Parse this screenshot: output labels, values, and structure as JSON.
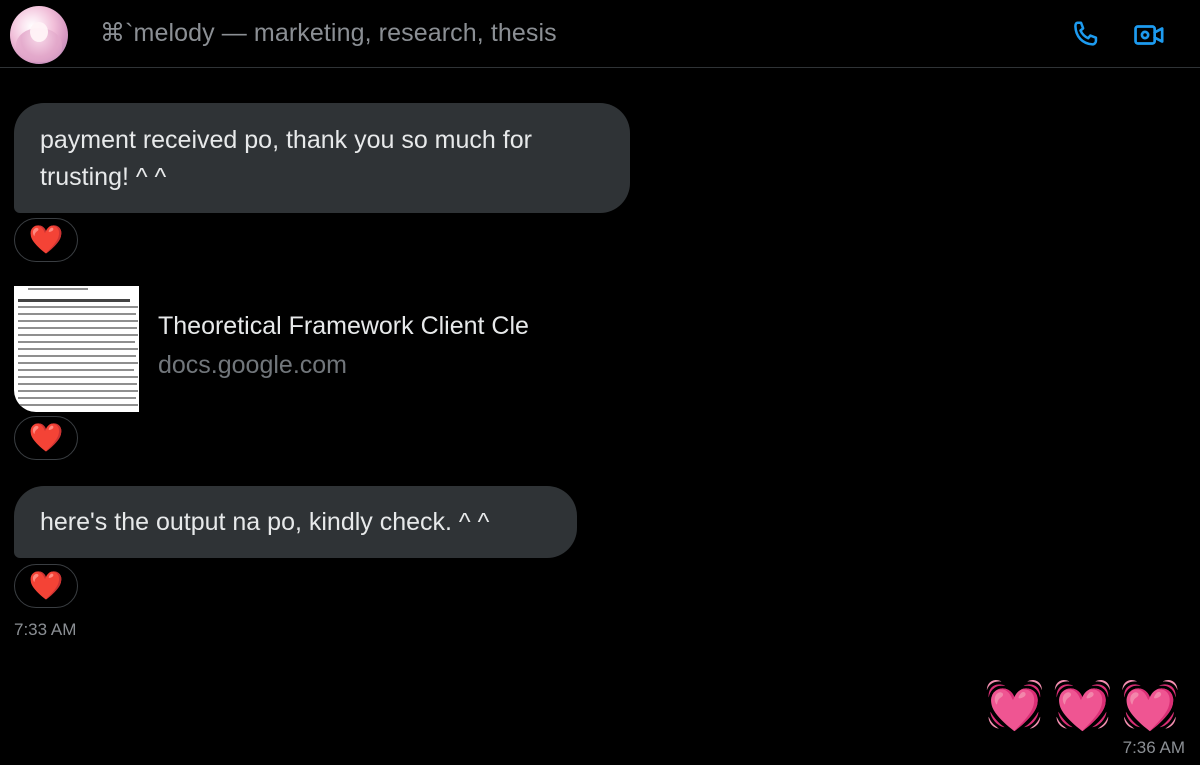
{
  "header": {
    "title": "⌘`melody — marketing, research, thesis",
    "phone_icon": "phone-icon",
    "video_icon": "video-call-icon",
    "accent_color": "#1d9bf0"
  },
  "messages": [
    {
      "text": "payment received po, thank you so much for trusting! ^ ^",
      "reaction": "❤️"
    },
    {
      "link_title": "Theoretical Framework Client Cle",
      "link_domain": "docs.google.com",
      "reaction": "❤️"
    },
    {
      "text": "here's the output na po, kindly check. ^ ^",
      "reaction": "❤️",
      "time": "7:33 AM"
    }
  ],
  "sent": {
    "emoji": "💓💓💓",
    "time": "7:36 AM"
  }
}
